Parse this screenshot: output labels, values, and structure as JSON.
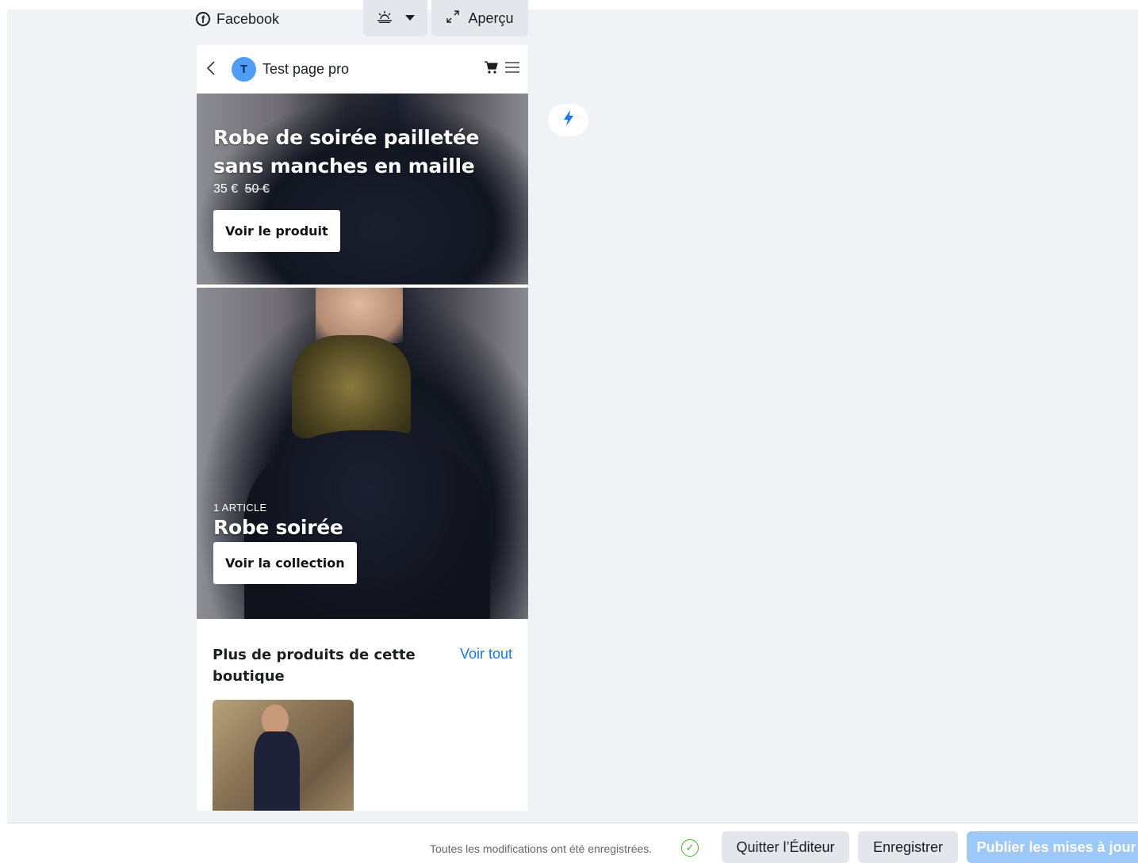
{
  "platform": {
    "icon": "facebook-icon",
    "label": "Facebook"
  },
  "toolbar": {
    "theme_icon": "sun-horizon-icon",
    "theme_caret": "caret-down-icon",
    "preview_icon": "expand-icon",
    "preview_label": "Aperçu"
  },
  "phone_header": {
    "back_icon": "chevron-left-icon",
    "avatar_letter": "T",
    "page_name": "Test page pro",
    "cart_icon": "cart-icon",
    "menu_icon": "hamburger-menu-icon"
  },
  "featured_product": {
    "title": "Robe de soirée pailletée sans manches en maille",
    "price": "35 €",
    "old_price": "50 €",
    "button_label": "Voir le produit"
  },
  "collection": {
    "count_label": "1 ARTICLE",
    "title": "Robe soirée",
    "button_label": "Voir la collection"
  },
  "more_products": {
    "title": "Plus de produits de cette boutique",
    "see_all_label": "Voir tout"
  },
  "side_action": {
    "icon": "lightning-icon"
  },
  "footer": {
    "status_text": "Toutes les modifications ont été enregistrées.",
    "status_icon": "check-circle-icon",
    "quit_label": "Quitter l’Éditeur",
    "save_label": "Enregistrer",
    "publish_label": "Publier les mises à jour"
  },
  "colors": {
    "accent": "#1877f2",
    "publish_disabled": "#9cc8fa",
    "canvas": "#f0f2f5",
    "avatar": "#4f9cf9"
  }
}
